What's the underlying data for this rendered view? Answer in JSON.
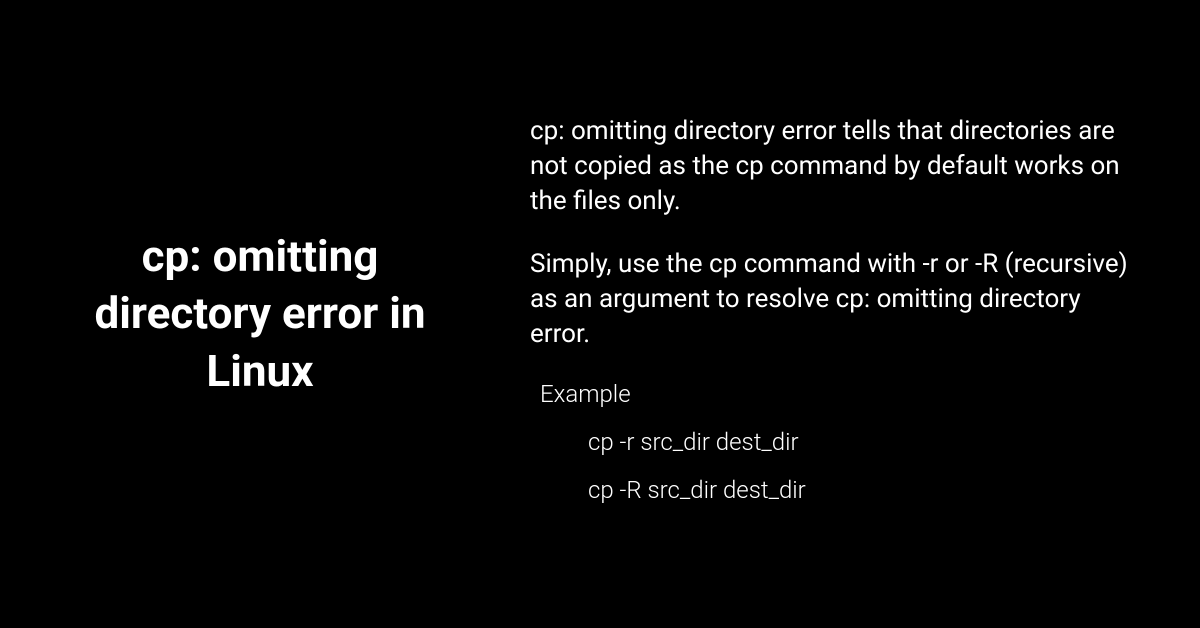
{
  "title": "cp: omitting directory error in Linux",
  "paragraph1": "cp: omitting directory error tells that directories are not copied as the cp command by default works on the files only.",
  "paragraph2": "Simply, use the cp command with  -r or -R (recursive) as an argument to resolve cp: omitting directory error.",
  "exampleLabel": "Example",
  "example1": "cp -r src_dir dest_dir",
  "example2": "cp -R src_dir dest_dir"
}
